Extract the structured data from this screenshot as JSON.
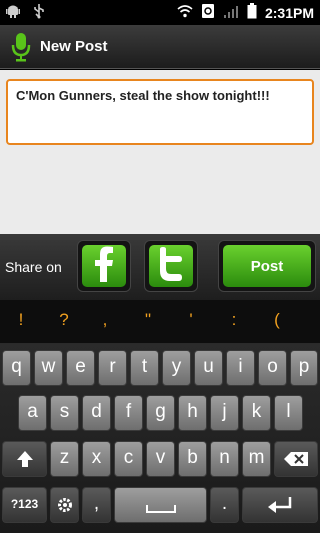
{
  "status": {
    "time": "2:31PM"
  },
  "header": {
    "title": "New Post"
  },
  "post": {
    "text": "C'Mon Gunners, steal the show tonight!!!"
  },
  "share": {
    "label": "Share on",
    "post_label": "Post"
  },
  "suggestions": [
    "!",
    "?",
    ",",
    "\"",
    "'",
    ":",
    "("
  ],
  "keyboard": {
    "row1": [
      "q",
      "w",
      "e",
      "r",
      "t",
      "y",
      "u",
      "i",
      "o",
      "p"
    ],
    "row2": [
      "a",
      "s",
      "d",
      "f",
      "g",
      "h",
      "j",
      "k",
      "l"
    ],
    "row3": [
      "z",
      "x",
      "c",
      "v",
      "b",
      "n",
      "m"
    ],
    "sym_label": "?123",
    "comma": ",",
    "period": "."
  }
}
